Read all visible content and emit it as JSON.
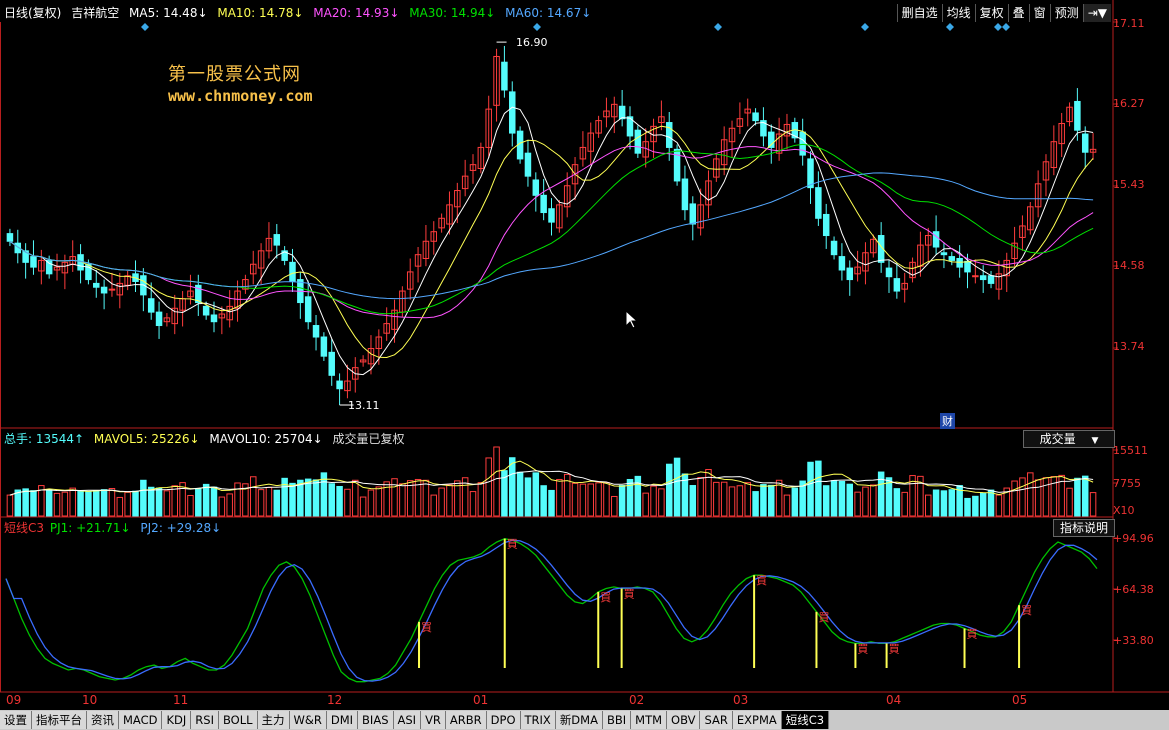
{
  "header": {
    "period": "日线(复权)",
    "stock": "吉祥航空",
    "ma5": "MA5: 14.48↓",
    "ma10": "MA10: 14.78↓",
    "ma20": "MA20: 14.93↓",
    "ma30": "MA30: 14.94↓",
    "ma60": "MA60: 14.67↓"
  },
  "toolbar": {
    "items": [
      "删自选",
      "均线",
      "复权",
      "叠",
      "窗",
      "预测"
    ],
    "end_icon": "⇥▼"
  },
  "watermark": {
    "line1": "第一股票公式网",
    "line2": "www.chnmoney.com"
  },
  "price_axis": [
    "17.11",
    "16.27",
    "15.43",
    "14.58",
    "13.74"
  ],
  "price_annotations": {
    "high": "16.90",
    "low": "13.11",
    "cai": "财"
  },
  "volume_header": {
    "total": "总手: 13544↑",
    "mavol5": "MAVOL5: 25226↓",
    "mavol10": "MAVOL10: 25704↓",
    "note": "成交量已复权",
    "selector": "成交量",
    "selector_arrow": "▼"
  },
  "volume_axis": [
    "15511",
    "7755",
    "X10"
  ],
  "indicator_header": {
    "name": "短线C3",
    "pj1": "PJ1: +21.71↓",
    "pj2": "PJ2: +29.28↓",
    "help_button": "指标说明"
  },
  "indicator_axis": [
    "+94.96",
    "+64.38",
    "+33.80"
  ],
  "signal_label": "買",
  "x_axis": [
    "09",
    "10",
    "11",
    "12",
    "01",
    "02",
    "03",
    "04",
    "05"
  ],
  "tabs": [
    "设置",
    "指标平台",
    "资讯",
    "MACD",
    "KDJ",
    "RSI",
    "BOLL",
    "主力",
    "W&R",
    "DMI",
    "BIAS",
    "ASI",
    "VR",
    "ARBR",
    "DPO",
    "TRIX",
    "新DMA",
    "BBI",
    "MTM",
    "OBV",
    "SAR",
    "EXPMA",
    "短线C3"
  ],
  "active_tab": "短线C3",
  "colors": {
    "up": "#ff3d3d",
    "down": "#54fcfc",
    "ma5": "#ffffff",
    "ma10": "#ffff54",
    "ma20": "#ff54ff",
    "ma30": "#00e000",
    "ma60": "#54a8ff",
    "axis": "#b81e1e"
  },
  "chart_data": {
    "type": "candlestick",
    "price_ylim": [
      13.11,
      17.11
    ],
    "close": [
      14.82,
      14.7,
      14.6,
      14.55,
      14.62,
      14.48,
      14.55,
      14.6,
      14.66,
      14.52,
      14.42,
      14.34,
      14.28,
      14.32,
      14.38,
      14.46,
      14.4,
      14.26,
      14.08,
      13.94,
      14.02,
      14.12,
      14.22,
      14.3,
      14.18,
      14.05,
      13.98,
      14.06,
      14.14,
      14.3,
      14.42,
      14.58,
      14.72,
      14.85,
      14.78,
      14.62,
      14.4,
      14.18,
      13.98,
      13.82,
      13.62,
      13.42,
      13.28,
      13.36,
      13.5,
      13.58,
      13.7,
      13.82,
      13.96,
      14.1,
      14.3,
      14.5,
      14.68,
      14.82,
      14.92,
      15.06,
      15.2,
      15.35,
      15.5,
      15.62,
      15.8,
      16.2,
      16.75,
      16.4,
      15.95,
      15.68,
      15.5,
      15.3,
      15.12,
      15.02,
      15.2,
      15.4,
      15.62,
      15.8,
      15.95,
      16.08,
      16.18,
      16.25,
      16.1,
      15.92,
      15.74,
      15.86,
      16.02,
      16.12,
      15.8,
      15.45,
      15.15,
      15.0,
      15.2,
      15.45,
      15.68,
      15.88,
      16.0,
      16.1,
      16.2,
      16.08,
      15.92,
      15.8,
      15.94,
      16.04,
      15.9,
      15.72,
      15.38,
      15.06,
      14.88,
      14.68,
      14.52,
      14.42,
      14.55,
      14.7,
      14.84,
      14.6,
      14.45,
      14.3,
      14.38,
      14.6,
      14.78,
      14.88,
      14.76,
      14.68,
      14.62,
      14.55,
      14.5,
      14.46,
      14.42,
      14.38,
      14.48,
      14.62,
      14.8,
      14.98,
      15.18,
      15.42,
      15.65,
      15.86,
      16.05,
      16.22,
      15.98,
      15.75,
      15.78
    ],
    "ma5_last": 14.48,
    "ma10_last": 14.78,
    "ma20_last": 14.93,
    "ma30_last": 14.94,
    "ma60_last": 14.67,
    "volume_ylim": [
      0,
      15511
    ],
    "volume_ticks": [
      15511,
      7755
    ],
    "indicator_ylim": [
      5,
      100
    ],
    "indicator_ticks": [
      94.96,
      64.38,
      33.8
    ],
    "pj1_last": 21.71,
    "pj2_last": 29.28,
    "pj_curve": [
      72,
      60,
      48,
      38,
      30,
      24,
      21,
      19,
      17,
      18,
      17,
      15,
      13,
      12,
      11,
      12,
      14,
      17,
      19,
      20,
      18,
      19,
      22,
      24,
      21,
      19,
      17,
      17,
      20,
      26,
      34,
      42,
      54,
      66,
      74,
      80,
      82,
      79,
      72,
      62,
      50,
      38,
      26,
      16,
      12,
      10,
      10,
      11,
      12,
      15,
      20,
      28,
      36,
      46,
      56,
      66,
      74,
      80,
      83,
      84,
      85,
      87,
      91,
      94,
      96,
      95,
      93,
      90,
      86,
      80,
      74,
      68,
      62,
      58,
      57,
      60,
      64,
      66,
      67,
      66,
      66,
      67,
      66,
      64,
      58,
      50,
      42,
      36,
      34,
      36,
      41,
      48,
      56,
      63,
      68,
      72,
      74,
      74,
      73,
      72,
      70,
      68,
      64,
      58,
      52,
      46,
      40,
      36,
      34,
      33,
      33,
      34,
      33,
      33,
      34,
      36,
      38,
      40,
      42,
      44,
      45,
      45,
      44,
      42,
      40,
      38,
      37,
      37,
      40,
      46,
      56,
      66,
      76,
      84,
      90,
      94,
      92,
      90,
      88,
      84,
      78
    ],
    "buy_signals": [
      53,
      64,
      76,
      79,
      96,
      104,
      109,
      113,
      123,
      130
    ],
    "x_ticks": [
      "09",
      "10",
      "11",
      "12",
      "01",
      "02",
      "03",
      "04",
      "05"
    ]
  }
}
